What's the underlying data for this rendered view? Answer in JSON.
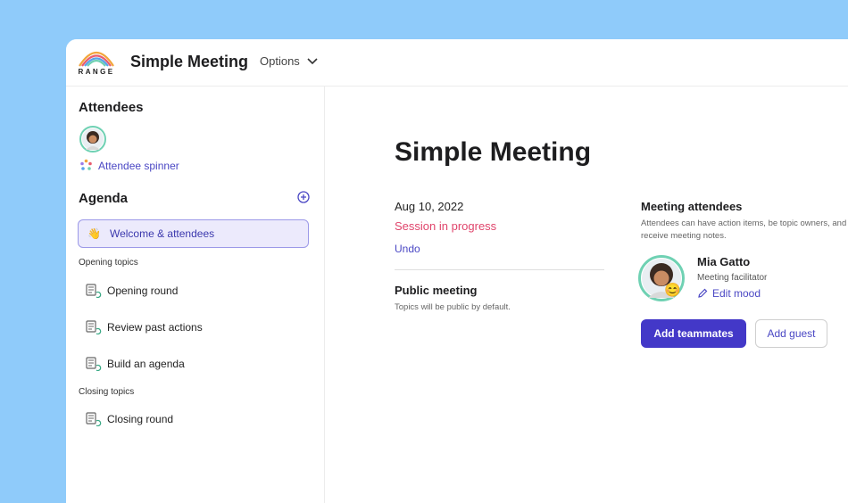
{
  "app": {
    "logo_text": "RANGE",
    "title": "Simple Meeting",
    "options_label": "Options"
  },
  "sidebar": {
    "attendees_heading": "Attendees",
    "attendee_spinner_label": "Attendee spinner",
    "agenda_heading": "Agenda",
    "active_item": {
      "emoji": "👋",
      "label": "Welcome & attendees"
    },
    "groups": [
      {
        "label": "Opening topics",
        "items": [
          "Opening round",
          "Review past actions",
          "Build an agenda"
        ]
      },
      {
        "label": "Closing topics",
        "items": [
          "Closing round"
        ]
      }
    ]
  },
  "main": {
    "title": "Simple Meeting",
    "date": "Aug 10, 2022",
    "status": "Session in progress",
    "undo_label": "Undo",
    "public_title": "Public meeting",
    "public_desc": "Topics will be public by default.",
    "attendees": {
      "heading": "Meeting attendees",
      "description": "Attendees can have action items, be topic owners, and receive meeting notes.",
      "person": {
        "name": "Mia Gatto",
        "role": "Meeting facilitator",
        "mood_emoji": "😊",
        "edit_mood_label": "Edit mood"
      },
      "add_teammates_label": "Add teammates",
      "add_guest_label": "Add guest"
    }
  },
  "colors": {
    "background": "#8fcbfa",
    "accent": "#4338c8",
    "status": "#e0456c",
    "avatar_ring": "#6fd1b3"
  },
  "icons": [
    "range-logo-icon",
    "chevron-down-icon",
    "spinner-dots-icon",
    "plus-circle-icon",
    "topic-doc-icon",
    "pencil-icon"
  ]
}
